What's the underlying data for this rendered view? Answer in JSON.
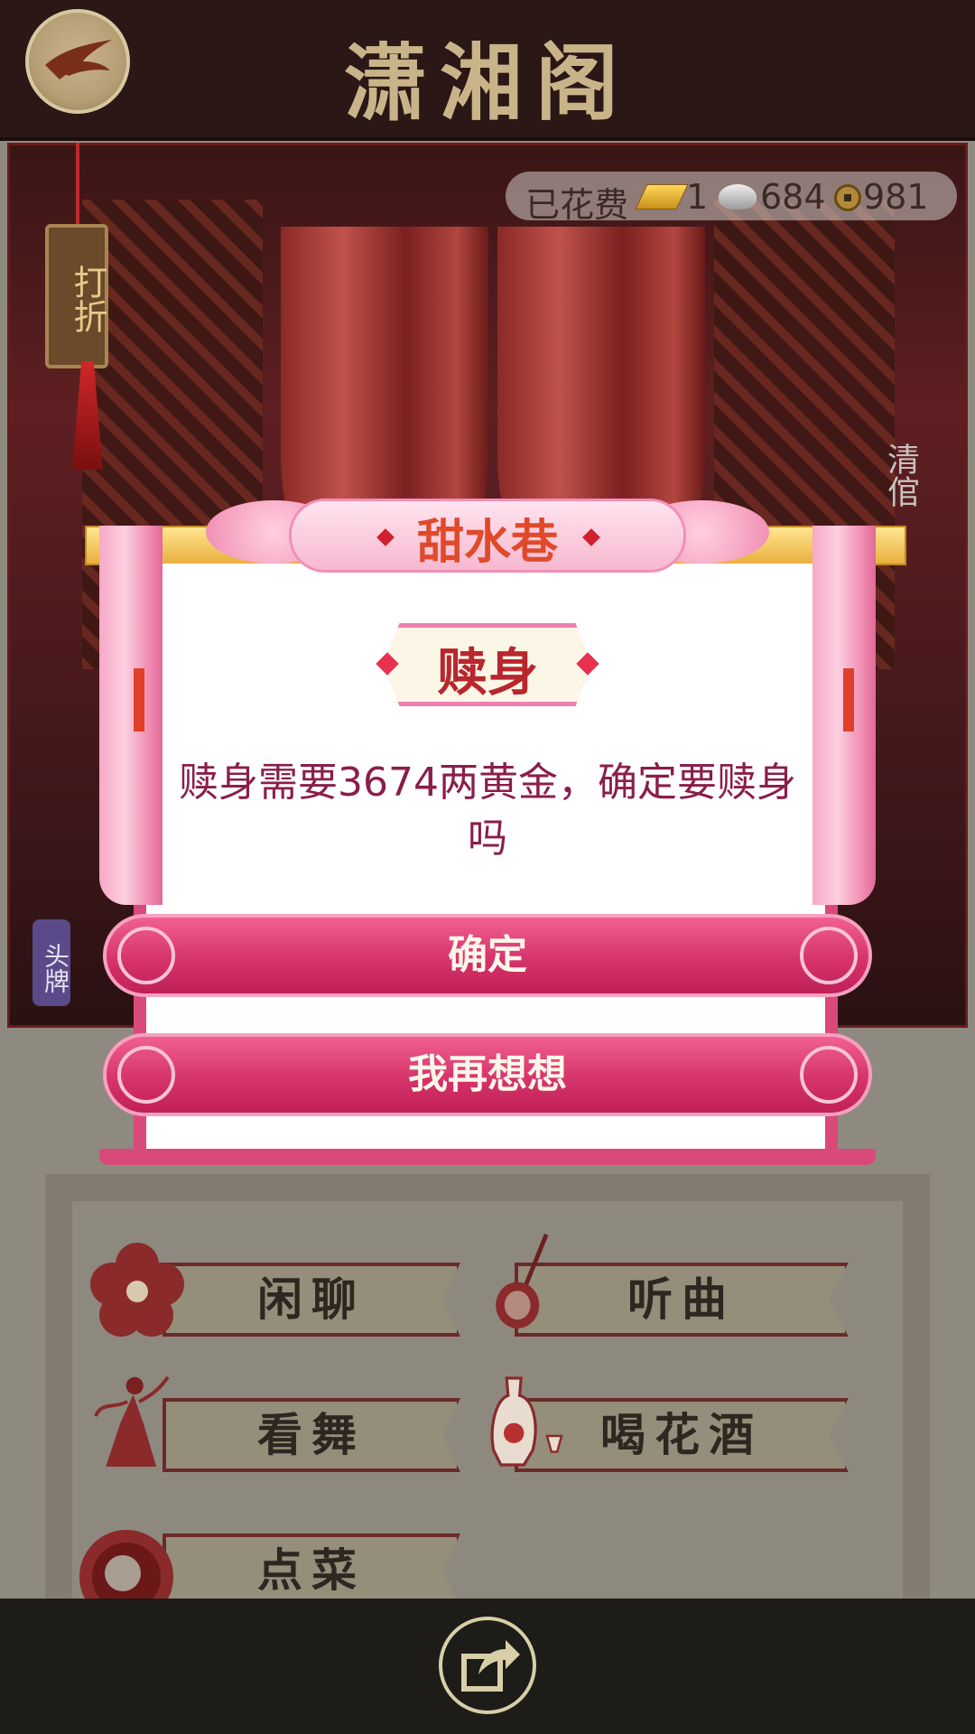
{
  "header": {
    "title": "潇湘阁",
    "back_icon": "back-arrow-icon"
  },
  "scene": {
    "spent_label": "已花费",
    "gold": "1",
    "silver": "684",
    "copper": "981",
    "discount_tag": "打折",
    "side_label": "清倌",
    "toupai_label": "头牌"
  },
  "dialog": {
    "location_title": "甜水巷",
    "heading": "赎身",
    "message": "赎身需要3674两黄金，确定要赎身吗",
    "confirm_label": "确定",
    "cancel_label": "我再想想"
  },
  "activities": [
    {
      "label": "闲聊",
      "icon": "flower-icon"
    },
    {
      "label": "听曲",
      "icon": "pipa-icon"
    },
    {
      "label": "看舞",
      "icon": "dancer-icon"
    },
    {
      "label": "喝花酒",
      "icon": "wine-pot-icon"
    },
    {
      "label": "点菜",
      "icon": "dish-icon"
    }
  ],
  "bottom_bar": {
    "share_icon": "share-icon"
  },
  "colors": {
    "header_bg": "#2a1716",
    "title_gold": "#c9b48a",
    "dialog_pink": "#d6346a",
    "dialog_title_red": "#e04a2a",
    "message_text": "#8a1e4a"
  }
}
